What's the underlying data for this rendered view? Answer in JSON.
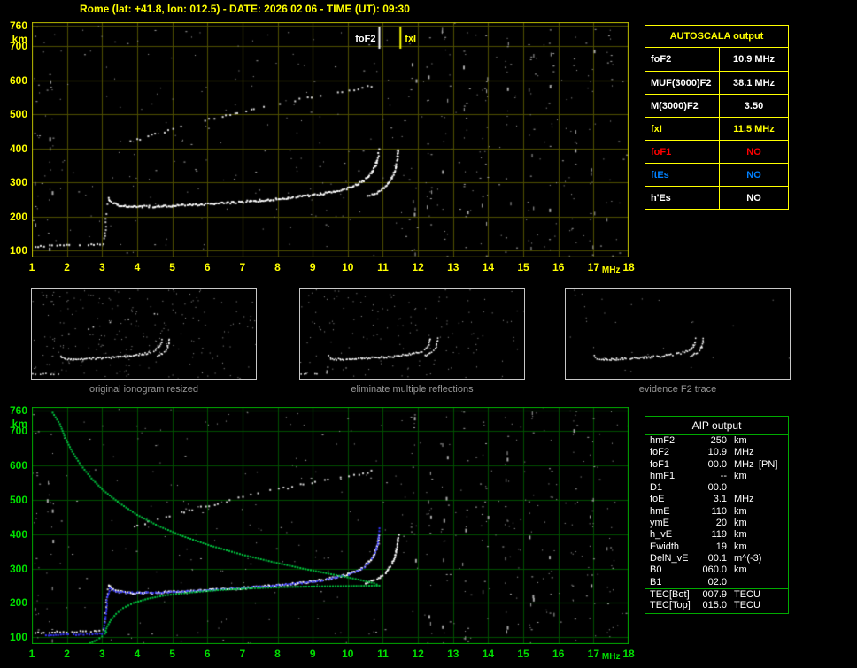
{
  "title": "Rome (lat: +41.8, lon: 012.5) - DATE: 2026 02 06 - TIME (UT): 09:30",
  "colors": {
    "background": "#000000",
    "title": "#ffff00",
    "yellow": "#ffff00",
    "white": "#ffffff",
    "red": "#ff0000",
    "blue": "#0080ff",
    "top_frame": "#bdbd00",
    "top_grid": "#4f4f00",
    "top_labels": "#ffff00",
    "bottom_frame": "#00a800",
    "bottom_grid": "#004f00",
    "bottom_labels": "#00e000",
    "trace": "#ffffff",
    "model_trace": "#3636ff",
    "profile": "#00c840",
    "fof2_marker": "#ffffff",
    "fxi_marker": "#ffff00",
    "caption": "#969696",
    "autoscala_border": "#ffff00",
    "aip_border": "#00aa00"
  },
  "autoscala_table": {
    "header": "AUTOSCALA output",
    "rows": [
      {
        "label": "foF2",
        "value": "10.9 MHz",
        "color": "white"
      },
      {
        "label": "MUF(3000)F2",
        "value": "38.1 MHz",
        "color": "white"
      },
      {
        "label": "M(3000)F2",
        "value": "3.50",
        "color": "white"
      },
      {
        "label": "fxI",
        "value": "11.5 MHz",
        "color": "yellow"
      },
      {
        "label": "foF1",
        "value": "NO",
        "color": "red"
      },
      {
        "label": "ftEs",
        "value": "NO",
        "color": "blue"
      },
      {
        "label": "h'Es",
        "value": "NO",
        "color": "white"
      }
    ]
  },
  "aip_table": {
    "header": "AIP output",
    "rows": [
      {
        "label": "hmF2",
        "value": "250",
        "unit": "km"
      },
      {
        "label": "foF2",
        "value": "10.9",
        "unit": "MHz"
      },
      {
        "label": "foF1",
        "value": "00.0",
        "unit": "MHz",
        "note": "[PN]"
      },
      {
        "label": "hmF1",
        "value": "--",
        "unit": "km"
      },
      {
        "label": "D1",
        "value": "00.0",
        "unit": ""
      },
      {
        "label": "foE",
        "value": "3.1",
        "unit": "MHz"
      },
      {
        "label": "hmE",
        "value": "110",
        "unit": "km"
      },
      {
        "label": "ymE",
        "value": "20",
        "unit": "km"
      },
      {
        "label": "h_vE",
        "value": "119",
        "unit": "km"
      },
      {
        "label": "Ewidth",
        "value": "19",
        "unit": "km"
      },
      {
        "label": "DelN_vE",
        "value": "00.1",
        "unit": "m^(-3)"
      },
      {
        "label": "B0",
        "value": "060.0",
        "unit": "km"
      },
      {
        "label": "B1",
        "value": "02.0",
        "unit": ""
      }
    ],
    "tec_rows": [
      {
        "label": "TEC[Bot]",
        "value": "007.9",
        "unit": "TECU"
      },
      {
        "label": "TEC[Top]",
        "value": "015.0",
        "unit": "TECU"
      }
    ]
  },
  "thumbnails": [
    {
      "caption": "original ionogram resized",
      "series_indices": [
        0,
        1,
        2,
        3,
        4
      ],
      "scatter_count": 230,
      "seed": 11
    },
    {
      "caption": "eliminate multiple reflections",
      "series_indices": [
        0,
        1,
        3,
        4
      ],
      "scatter_count": 150,
      "seed": 12
    },
    {
      "caption": "evidence F2 trace",
      "series_indices": [
        0,
        1
      ],
      "scatter_count": 28,
      "seed": 13
    }
  ],
  "chart_data": [
    {
      "id": "recorded_ionogram",
      "type": "scatter",
      "title": "recorded ionogram (Rome 2026-02-06 09:30 UT)",
      "xlabel": "MHz",
      "ylabel": "km",
      "xlim": [
        1,
        18
      ],
      "ylim": [
        80,
        770
      ],
      "x_ticks": [
        1,
        2,
        3,
        4,
        5,
        6,
        7,
        8,
        9,
        10,
        11,
        12,
        13,
        14,
        15,
        16,
        17,
        18
      ],
      "y_ticks": [
        760,
        700,
        600,
        500,
        400,
        300,
        200,
        100
      ],
      "grid": true,
      "markers": [
        {
          "label": "foF2",
          "mhz": 10.9,
          "color_key": "fof2_marker"
        },
        {
          "label": "fxI",
          "mhz": 11.5,
          "color_key": "fxi_marker"
        }
      ],
      "noise": {
        "seed": 42,
        "scatter_count": 300,
        "color": "#a8a8a8",
        "columns": [
          1.12,
          1.5,
          11.85,
          12.3,
          12.75,
          13.35,
          13.9,
          14.55,
          15.2,
          15.8,
          16.45,
          16.95,
          17.45
        ],
        "column_count": 14
      },
      "series": [
        {
          "name": "F2-ordinary-trace",
          "style": {
            "color": "#ffffff",
            "size": 2,
            "spacing": 1.6,
            "jx": 1.2,
            "jy": 2.2,
            "density": 0.95
          },
          "points": [
            [
              3.18,
              252
            ],
            [
              3.28,
              240
            ],
            [
              3.45,
              233
            ],
            [
              3.7,
              230
            ],
            [
              4.0,
              229
            ],
            [
              4.4,
              229
            ],
            [
              4.9,
              231
            ],
            [
              5.4,
              233
            ],
            [
              5.9,
              236
            ],
            [
              6.4,
              239
            ],
            [
              6.9,
              242
            ],
            [
              7.4,
              246
            ],
            [
              7.9,
              250
            ],
            [
              8.4,
              255
            ],
            [
              8.9,
              261
            ],
            [
              9.3,
              267
            ],
            [
              9.7,
              275
            ],
            [
              10.0,
              283
            ],
            [
              10.25,
              293
            ],
            [
              10.45,
              305
            ],
            [
              10.6,
              318
            ],
            [
              10.72,
              334
            ],
            [
              10.81,
              355
            ],
            [
              10.87,
              378
            ],
            [
              10.9,
              400
            ]
          ]
        },
        {
          "name": "F2-extraordinary-trace",
          "style": {
            "color": "#ffffff",
            "size": 2,
            "spacing": 1.8,
            "jx": 1.2,
            "jy": 2.2,
            "density": 0.92
          },
          "points": [
            [
              10.52,
              258
            ],
            [
              10.7,
              264
            ],
            [
              10.88,
              272
            ],
            [
              11.02,
              282
            ],
            [
              11.14,
              294
            ],
            [
              11.24,
              309
            ],
            [
              11.32,
              327
            ],
            [
              11.38,
              349
            ],
            [
              11.42,
              374
            ],
            [
              11.45,
              400
            ]
          ]
        },
        {
          "name": "F2-second-hop-echo",
          "style": {
            "color": "#d8d8d8",
            "size": 2,
            "spacing": 4.5,
            "jx": 2.5,
            "jy": 2.5,
            "density": 0.55
          },
          "points": [
            [
              3.8,
              418
            ],
            [
              4.3,
              434
            ],
            [
              4.9,
              452
            ],
            [
              5.6,
              472
            ],
            [
              6.3,
              490
            ],
            [
              7.0,
              507
            ],
            [
              7.7,
              523
            ],
            [
              8.4,
              538
            ],
            [
              9.1,
              552
            ],
            [
              9.7,
              564
            ],
            [
              10.3,
              575
            ],
            [
              10.8,
              585
            ]
          ]
        },
        {
          "name": "E-region-trace",
          "style": {
            "color": "#e6e6e6",
            "size": 2,
            "spacing": 3,
            "jx": 1.5,
            "jy": 1.5,
            "density": 0.75
          },
          "points": [
            [
              1.1,
              112
            ],
            [
              1.5,
              114
            ],
            [
              1.9,
              115
            ],
            [
              2.3,
              116
            ],
            [
              2.7,
              117
            ],
            [
              3.0,
              118
            ]
          ]
        },
        {
          "name": "foE-retardation-cusp",
          "style": {
            "color": "#c8c8c8",
            "size": 2,
            "spacing": 3.5,
            "jx": 1.2,
            "jy": 2.5,
            "density": 0.6
          },
          "points": [
            [
              3.05,
              120
            ],
            [
              3.08,
              145
            ],
            [
              3.1,
              172
            ],
            [
              3.12,
              200
            ],
            [
              3.15,
              228
            ],
            [
              3.18,
              246
            ]
          ]
        }
      ]
    },
    {
      "id": "autoscaled_ionogram_with_profile",
      "type": "scatter",
      "title": "autoscaled ionogram, restored trace (blue) and electron density profile (green)",
      "includes_series_of": "recorded_ionogram",
      "xlabel": "MHz",
      "ylabel": "km",
      "xlim": [
        1,
        18
      ],
      "ylim": [
        80,
        770
      ],
      "x_ticks": [
        1,
        2,
        3,
        4,
        5,
        6,
        7,
        8,
        9,
        10,
        11,
        12,
        13,
        14,
        15,
        16,
        17,
        18
      ],
      "y_ticks": [
        760,
        700,
        600,
        500,
        400,
        300,
        200,
        100
      ],
      "grid": true,
      "markers": [],
      "noise": {
        "seed": 77,
        "scatter_count": 300,
        "color": "#a8a8a8",
        "columns": [
          1.12,
          1.5,
          11.85,
          12.3,
          12.75,
          13.35,
          13.9,
          14.55,
          15.2,
          15.8,
          16.45,
          16.95,
          17.45
        ],
        "column_count": 14
      },
      "series": [
        {
          "name": "restored-trace-model",
          "style": {
            "color": "#3636ff",
            "size": 2,
            "spacing": 3,
            "jx": 0.8,
            "jy": 1.2,
            "density": 0.95
          },
          "points": [
            [
              1.4,
              106
            ],
            [
              1.9,
              107
            ],
            [
              2.4,
              108
            ],
            [
              2.8,
              109
            ],
            [
              3.0,
              110
            ],
            [
              3.05,
              118
            ],
            [
              3.1,
              160
            ],
            [
              3.15,
              215
            ],
            [
              3.22,
              242
            ],
            [
              3.4,
              233
            ],
            [
              3.7,
              230
            ],
            [
              4.1,
              229
            ],
            [
              4.6,
              230
            ],
            [
              5.1,
              232
            ],
            [
              5.7,
              235
            ],
            [
              6.3,
              238
            ],
            [
              6.9,
              242
            ],
            [
              7.5,
              247
            ],
            [
              8.1,
              252
            ],
            [
              8.7,
              258
            ],
            [
              9.2,
              264
            ],
            [
              9.7,
              275
            ],
            [
              10.1,
              285
            ],
            [
              10.4,
              298
            ],
            [
              10.6,
              315
            ],
            [
              10.74,
              336
            ],
            [
              10.83,
              360
            ],
            [
              10.88,
              385
            ],
            [
              10.9,
              425
            ]
          ]
        },
        {
          "name": "electron-density-profile",
          "style": {
            "color": "#00c840",
            "size": 2,
            "spacing": 3,
            "jx": 0,
            "jy": 0,
            "density": 1
          },
          "points": [
            [
              2.6,
              80
            ],
            [
              2.85,
              92
            ],
            [
              3.0,
              102
            ],
            [
              3.08,
              110
            ],
            [
              3.12,
              114
            ],
            [
              3.1,
              119
            ],
            [
              3.15,
              132
            ],
            [
              3.25,
              150
            ],
            [
              3.4,
              168
            ],
            [
              3.6,
              185
            ],
            [
              3.9,
              200
            ],
            [
              4.3,
              212
            ],
            [
              4.8,
              222
            ],
            [
              5.5,
              230
            ],
            [
              6.3,
              237
            ],
            [
              7.2,
              242
            ],
            [
              8.2,
              246
            ],
            [
              9.2,
              248
            ],
            [
              10.1,
              249
            ],
            [
              10.9,
              250
            ],
            [
              10.75,
              257
            ],
            [
              10.3,
              268
            ],
            [
              9.6,
              282
            ],
            [
              8.8,
              298
            ],
            [
              7.9,
              318
            ],
            [
              7.0,
              340
            ],
            [
              6.1,
              366
            ],
            [
              5.3,
              394
            ],
            [
              4.6,
              424
            ],
            [
              4.0,
              456
            ],
            [
              3.5,
              490
            ],
            [
              3.05,
              526
            ],
            [
              2.7,
              562
            ],
            [
              2.4,
              600
            ],
            [
              2.15,
              640
            ],
            [
              1.95,
              680
            ],
            [
              1.8,
              720
            ],
            [
              1.55,
              760
            ]
          ]
        }
      ]
    }
  ]
}
